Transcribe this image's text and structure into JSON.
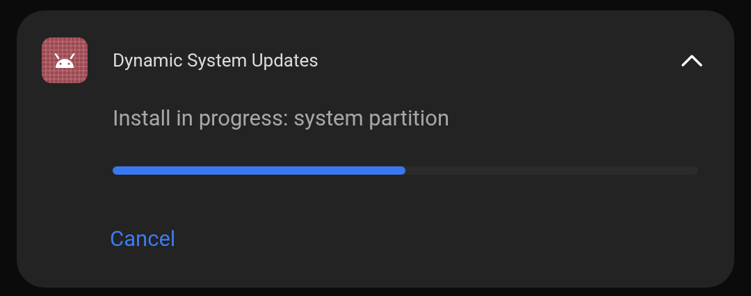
{
  "notification": {
    "app_name": "Dynamic System Updates",
    "expanded": true,
    "message": "Install in progress: system partition",
    "progress": {
      "level": 0.5
    },
    "actions": [
      {
        "label": "Cancel"
      }
    ]
  }
}
